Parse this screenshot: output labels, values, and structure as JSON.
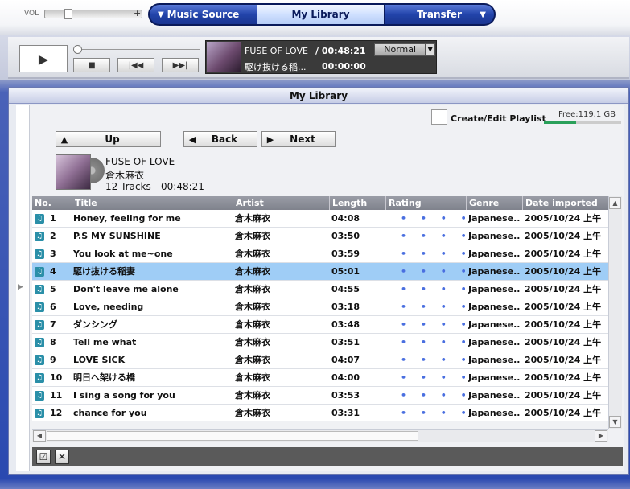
{
  "volume": {
    "label": "VOL",
    "minus": "−",
    "plus": "+",
    "level": 0.15
  },
  "nav": {
    "items": [
      {
        "label": "Music Source"
      },
      {
        "label": "My Library"
      },
      {
        "label": "Transfer"
      }
    ]
  },
  "player": {
    "play_icon": "▶",
    "stop_icon": "■",
    "prev_icon": "|◀◀",
    "next_icon": "▶▶|",
    "now_title": "FUSE OF LOVE",
    "now_total": "/ 00:48:21",
    "now_sub": "駆け抜ける稲...",
    "now_current": "00:00:00",
    "mode": "Normal"
  },
  "library": {
    "title": "My Library",
    "playlist_label": "Create/Edit Playlist",
    "free_label": "Free:119.1  GB",
    "buttons": {
      "up": "Up",
      "back": "Back",
      "next": "Next"
    },
    "album": {
      "title": "FUSE OF LOVE",
      "artist": "倉木麻衣",
      "tracks": "12 Tracks",
      "duration": "00:48:21"
    },
    "columns": [
      "No.",
      "Title",
      "Artist",
      "Length",
      "Rating",
      "Genre",
      "Date imported"
    ],
    "rows": [
      {
        "no": "1",
        "title": "Honey, feeling for me",
        "artist": "倉木麻衣",
        "length": "04:08",
        "rating": "• • • • •",
        "genre": "Japanese...",
        "date": "2005/10/24 上午"
      },
      {
        "no": "2",
        "title": "P.S MY SUNSHINE",
        "artist": "倉木麻衣",
        "length": "03:50",
        "rating": "• • • • •",
        "genre": "Japanese...",
        "date": "2005/10/24 上午"
      },
      {
        "no": "3",
        "title": "You look at me~one",
        "artist": "倉木麻衣",
        "length": "03:59",
        "rating": "• • • • •",
        "genre": "Japanese...",
        "date": "2005/10/24 上午"
      },
      {
        "no": "4",
        "title": "駆け抜ける稲妻",
        "artist": "倉木麻衣",
        "length": "05:01",
        "rating": "• • • • •",
        "genre": "Japanese...",
        "date": "2005/10/24 上午"
      },
      {
        "no": "5",
        "title": "Don't leave me alone",
        "artist": "倉木麻衣",
        "length": "04:55",
        "rating": "• • • • •",
        "genre": "Japanese...",
        "date": "2005/10/24 上午"
      },
      {
        "no": "6",
        "title": "Love, needing",
        "artist": "倉木麻衣",
        "length": "03:18",
        "rating": "• • • • •",
        "genre": "Japanese...",
        "date": "2005/10/24 上午"
      },
      {
        "no": "7",
        "title": "ダンシング",
        "artist": "倉木麻衣",
        "length": "03:48",
        "rating": "• • • • •",
        "genre": "Japanese...",
        "date": "2005/10/24 上午"
      },
      {
        "no": "8",
        "title": "Tell me what",
        "artist": "倉木麻衣",
        "length": "03:51",
        "rating": "• • • • •",
        "genre": "Japanese...",
        "date": "2005/10/24 上午"
      },
      {
        "no": "9",
        "title": "LOVE SICK",
        "artist": "倉木麻衣",
        "length": "04:07",
        "rating": "• • • • •",
        "genre": "Japanese...",
        "date": "2005/10/24 上午"
      },
      {
        "no": "10",
        "title": "明日へ架ける橋",
        "artist": "倉木麻衣",
        "length": "04:00",
        "rating": "• • • • •",
        "genre": "Japanese...",
        "date": "2005/10/24 上午"
      },
      {
        "no": "11",
        "title": "I sing a song for you",
        "artist": "倉木麻衣",
        "length": "03:53",
        "rating": "• • • • •",
        "genre": "Japanese...",
        "date": "2005/10/24 上午"
      },
      {
        "no": "12",
        "title": "chance for you",
        "artist": "倉木麻衣",
        "length": "03:31",
        "rating": "• • • • •",
        "genre": "Japanese...",
        "date": "2005/10/24 上午"
      }
    ],
    "selected_row": 4
  },
  "colors": {
    "accent": "#2244aa",
    "selection": "#9fcdf6",
    "nav_dark": "#0a1a5a",
    "rating": "#4a6fe0"
  }
}
